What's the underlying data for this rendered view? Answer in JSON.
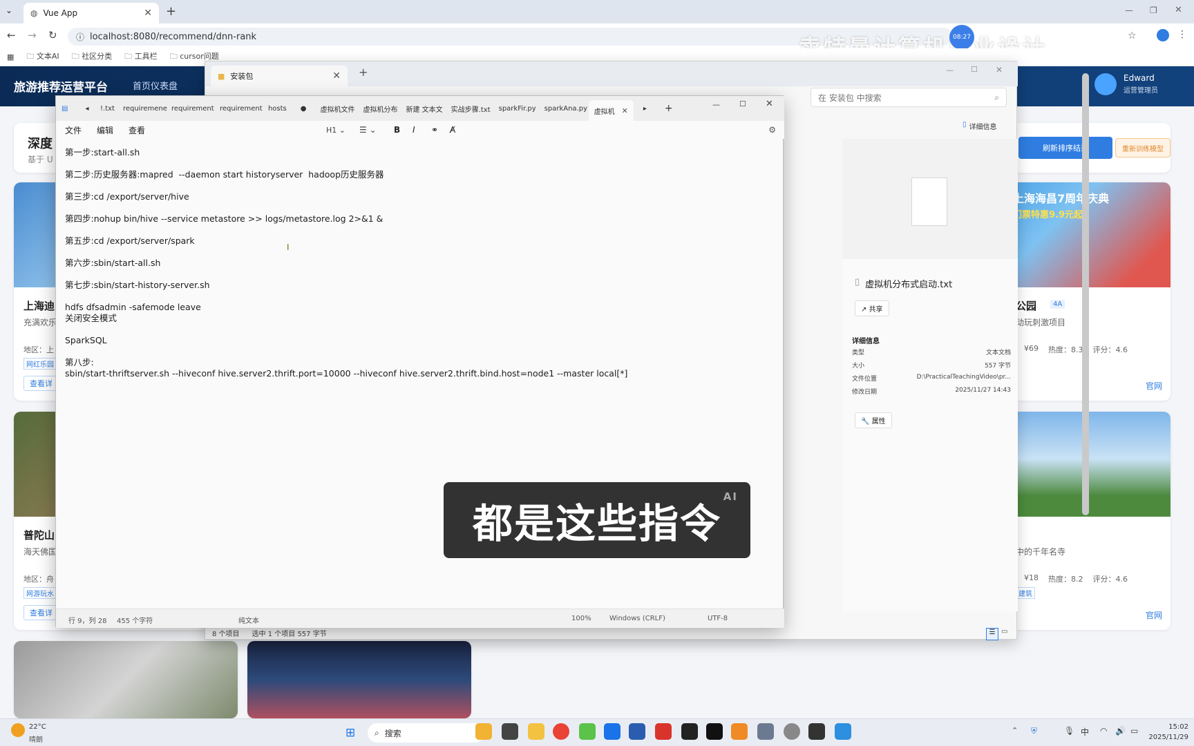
{
  "browser": {
    "tab_title": "Vue App",
    "url": "localhost:8080/recommend/dnn-rank",
    "bookmarks": [
      "文本AI",
      "社区分类",
      "工具栏",
      "cursor问题"
    ],
    "watermark": "卖特曼计算机毕业设计",
    "clock_badge": "08:27"
  },
  "app": {
    "brand": "旅游推荐运营平台",
    "nav_first": "首页仪表盘",
    "user_name": "Edward",
    "user_role": "运营管理员",
    "page_title_partial": "深度",
    "page_sub_partial": "基于 U",
    "refresh_button": "刷新排序结果",
    "retrain_button": "重新训练模型",
    "cards": [
      {
        "title": "上海迪",
        "desc": "充满欢乐",
        "region": "地区：上",
        "tag": "网红乐园",
        "detail": "查看详"
      },
      {
        "title": "普陀山",
        "desc": "海天佛国",
        "region": "地区：舟",
        "tag": "网游玩水",
        "detail": "查看详"
      }
    ],
    "right_cards": [
      {
        "title": "公园",
        "level": "4A",
        "desc": "动玩刺激项目",
        "price": "¥69",
        "heat": "热度：8.3",
        "score": "评分：4.6",
        "link": "官网",
        "ad": "上海海昌7周年庆典",
        "ad2": "门票特惠9.9元起"
      },
      {
        "title": "",
        "desc": "中的千年名寺",
        "price": "¥18",
        "heat": "热度：8.2",
        "score": "评分：4.6",
        "link": "官网",
        "tag": "建筑"
      }
    ]
  },
  "explorer": {
    "title": "安装包",
    "search_placeholder": "在 安装包 中搜索",
    "details_toggle": "详细信息",
    "file_name": "虚拟机分布式启动.txt",
    "share": "共享",
    "details_header": "详细信息",
    "props": [
      {
        "k": "类型",
        "v": "文本文档"
      },
      {
        "k": "大小",
        "v": "557 字节"
      },
      {
        "k": "文件位置",
        "v": "D:\\PracticalTeachingVideo\\pr..."
      },
      {
        "k": "修改日期",
        "v": "2025/11/27 14:43"
      }
    ],
    "properties_button": "属性",
    "status_items": "8 个项目",
    "status_selected": "选中 1 个项目  557 字节"
  },
  "notepad": {
    "tabs": [
      "!.txt",
      "requiremene",
      "requirement",
      "requirement",
      "hosts",
      "●",
      "虚拟机文件",
      "虚拟机分布",
      "新建 文本文",
      "实战步骤.txt",
      "sparkFir.py",
      "sparkAna.py",
      "虚拟机"
    ],
    "menu": [
      "文件",
      "编辑",
      "查看"
    ],
    "heading": "H1",
    "lines": [
      "第一步:start-all.sh",
      "",
      "第二步:历史服务器:mapred  --daemon start historyserver  hadoop历史服务器",
      "",
      "第三步:cd /export/server/hive",
      "",
      "第四步:nohup bin/hive --service metastore >> logs/metastore.log 2>&1 &",
      "",
      "第五步:cd /export/server/spark",
      "",
      "第六步:sbin/start-all.sh",
      "",
      "第七步:sbin/start-history-server.sh",
      "",
      "hdfs dfsadmin -safemode leave",
      "关闭安全模式",
      "",
      "SparkSQL",
      "",
      "第八步:",
      "sbin/start-thriftserver.sh --hiveconf hive.server2.thrift.port=10000 --hiveconf hive.server2.thrift.bind.host=node1 --master local[*]"
    ],
    "status": {
      "pos": "行 9，列 28",
      "chars": "455 个字符",
      "format": "纯文本",
      "zoom": "100%",
      "eol": "Windows (CRLF)",
      "enc": "UTF-8"
    }
  },
  "subtitle": {
    "text": "都是这些指令",
    "badge": "AI"
  },
  "taskbar": {
    "weather_temp": "22°C",
    "weather_desc": "晴朗",
    "search": "搜索",
    "ime": "中",
    "time": "15:02",
    "date": "2025/11/29"
  }
}
